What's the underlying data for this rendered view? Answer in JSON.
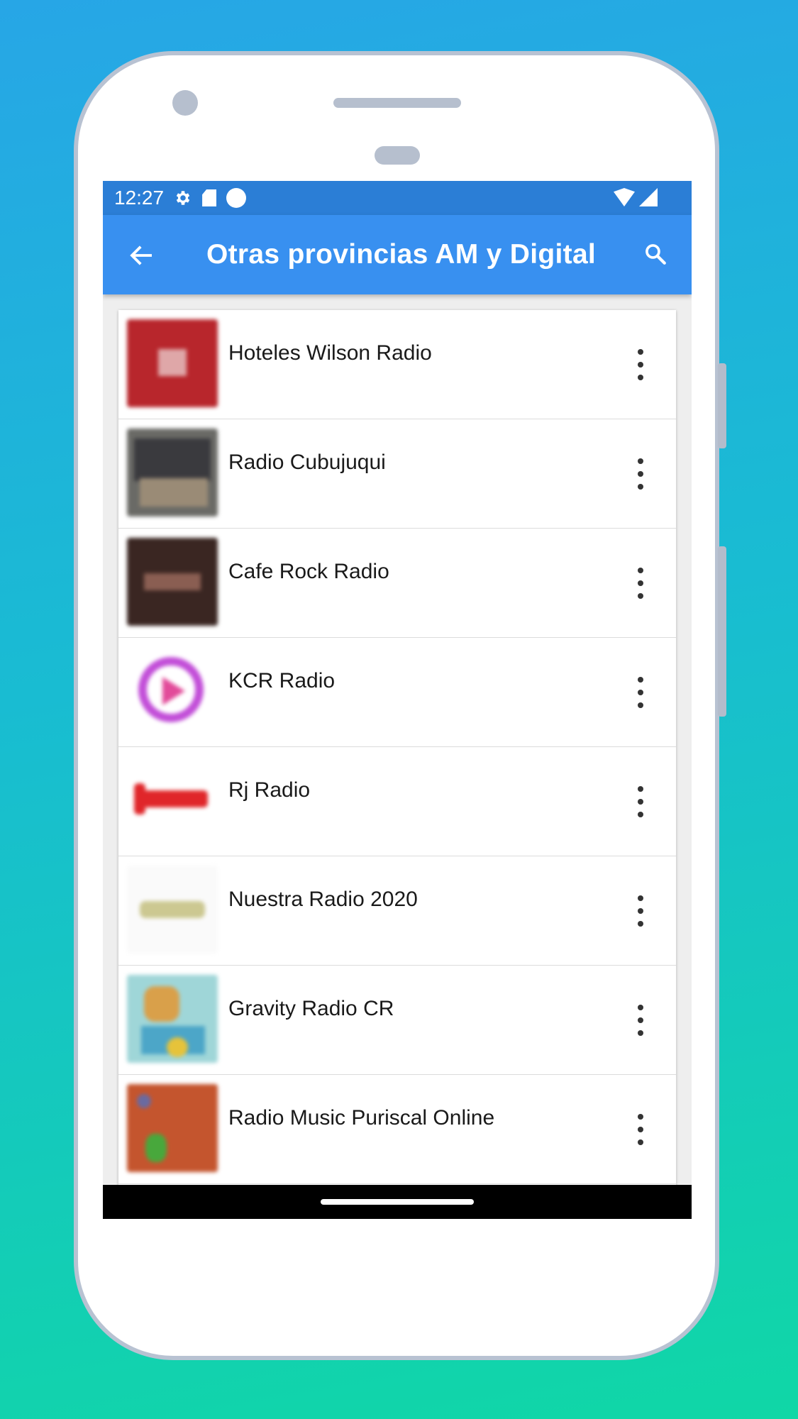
{
  "status_bar": {
    "time": "12:27"
  },
  "app_bar": {
    "title": "Otras provincias AM y Digital"
  },
  "stations": [
    {
      "name": "Hoteles Wilson Radio"
    },
    {
      "name": "Radio Cubujuqui"
    },
    {
      "name": "Cafe Rock Radio"
    },
    {
      "name": "KCR Radio"
    },
    {
      "name": "Rj Radio"
    },
    {
      "name": "Nuestra Radio 2020"
    },
    {
      "name": "Gravity Radio CR"
    },
    {
      "name": "Radio Music Puriscal Online"
    }
  ],
  "colors": {
    "app_bar": "#3890f0",
    "status_bar": "#2b7ed6",
    "background_top": "#27a6e6",
    "background_bottom": "#10d7a6"
  }
}
